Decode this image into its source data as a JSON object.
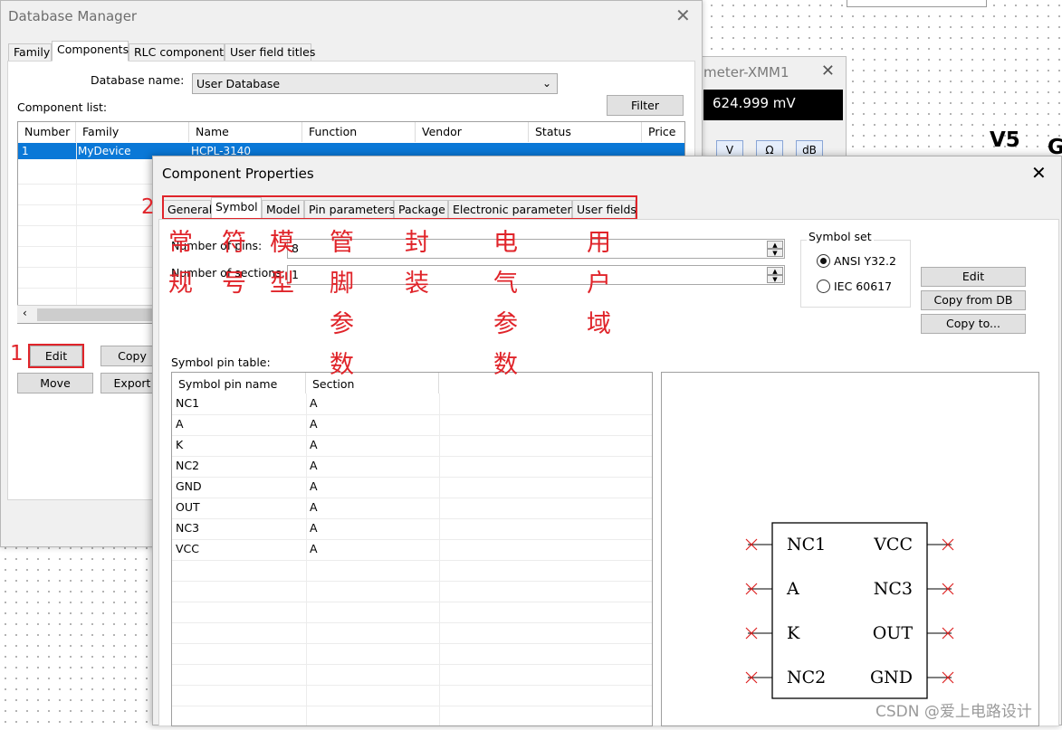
{
  "background": {
    "multimeter": {
      "title": "meter-XMM1",
      "reading": "624.999 mV",
      "buttons": [
        "V",
        "Ω",
        "dB"
      ]
    },
    "schematic_label_v5": "V5",
    "schematic_label_g": "G"
  },
  "db_manager": {
    "title": "Database Manager",
    "tabs": [
      "Family",
      "Components",
      "RLC components",
      "User field titles"
    ],
    "active_tab": "Components",
    "database_name_label": "Database name:",
    "database_name_value": "User Database",
    "component_list_label": "Component list:",
    "filter_button": "Filter",
    "columns": [
      "Number",
      "Family",
      "Name",
      "Function",
      "Vendor",
      "Status",
      "Price"
    ],
    "rows": [
      {
        "number": "1",
        "family": "MyDevice",
        "name": "HCPL-3140"
      }
    ],
    "buttons": {
      "edit": "Edit",
      "copy": "Copy",
      "move": "Move",
      "export": "Export"
    }
  },
  "component_properties": {
    "title": "Component Properties",
    "tabs": [
      "General",
      "Symbol",
      "Model",
      "Pin parameters",
      "Package",
      "Electronic parameters",
      "User fields"
    ],
    "active_tab": "Symbol",
    "number_of_pins_label": "Number of pins:",
    "number_of_pins_value": "8",
    "number_of_sections_label": "Number of sections:",
    "number_of_sections_value": "1",
    "symbol_set": {
      "label": "Symbol set",
      "options": [
        "ANSI Y32.2",
        "IEC 60617"
      ],
      "selected": "ANSI Y32.2"
    },
    "buttons": {
      "edit": "Edit",
      "copy_from_db": "Copy from DB",
      "copy_to": "Copy to..."
    },
    "symbol_pin_table_label": "Symbol pin table:",
    "pin_table_columns": [
      "Symbol pin name",
      "Section"
    ],
    "pin_rows": [
      {
        "name": "NC1",
        "section": "A"
      },
      {
        "name": "A",
        "section": "A"
      },
      {
        "name": "K",
        "section": "A"
      },
      {
        "name": "NC2",
        "section": "A"
      },
      {
        "name": "GND",
        "section": "A"
      },
      {
        "name": "OUT",
        "section": "A"
      },
      {
        "name": "NC3",
        "section": "A"
      },
      {
        "name": "VCC",
        "section": "A"
      }
    ],
    "symbol_preview": {
      "left_pins": [
        "NC1",
        "A",
        "K",
        "NC2"
      ],
      "right_pins": [
        "VCC",
        "NC3",
        "OUT",
        "GND"
      ]
    }
  },
  "annotations": {
    "marker_1": "1",
    "marker_2": "2",
    "tab_translations": [
      [
        "常",
        "规"
      ],
      [
        "符",
        "号"
      ],
      [
        "模",
        "型"
      ],
      [
        "管",
        "脚",
        "参",
        "数"
      ],
      [
        "封",
        "装"
      ],
      [
        "电",
        "气",
        "参",
        "数"
      ],
      [
        "用",
        "户",
        "域"
      ]
    ],
    "color": "#e0242a"
  },
  "watermark": "CSDN @爱上电路设计"
}
